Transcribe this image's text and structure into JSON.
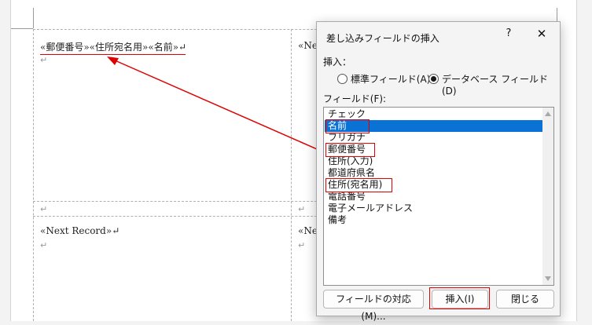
{
  "document": {
    "cell1_fields": "«郵便番号»«住所宛名用»«名前»↵",
    "cell1_para": "↵",
    "cell2_partial": "«Nex",
    "mid_para_left": "↵",
    "mid_para_right": "↵",
    "cell3_text": "«Next Record»↵",
    "cell3_para": "↵",
    "cell4_partial": "«Nex",
    "cell4_para": "↵"
  },
  "dialog": {
    "title": "差し込みフィールドの挿入",
    "help_label": "?",
    "close_label": "✕",
    "insert_group_label": "挿入：",
    "radio_standard": "標準フィールド(A)",
    "radio_database": "データベース フィールド(D)",
    "radio_selected": "database",
    "field_list_label": "フィールド(F):",
    "fields": [
      "チェック",
      "名前",
      "フリガナ",
      "郵便番号",
      "住所(入力)",
      "都道府県名",
      "住所(宛名用)",
      "電話番号",
      "電子メールアドレス",
      "備考"
    ],
    "selected_field": "名前",
    "highlighted_fields": [
      "名前",
      "郵便番号",
      "住所(宛名用)"
    ],
    "button_match": "フィールドの対応(M)...",
    "button_insert": "挿入(I)",
    "button_close": "閉じる"
  },
  "colors": {
    "selection": "#0a72d4",
    "annotation": "#e00000"
  }
}
